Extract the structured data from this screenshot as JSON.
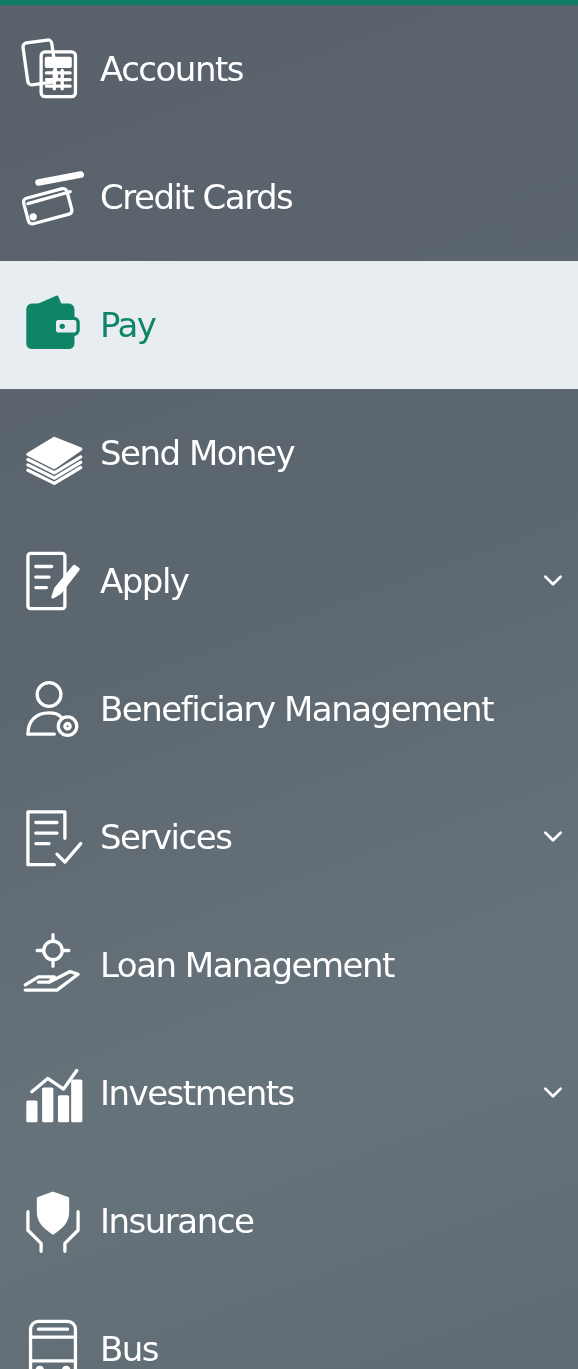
{
  "menu": [
    {
      "label": "Accounts",
      "kind": "link",
      "selected": false
    },
    {
      "label": "Credit Cards",
      "kind": "link",
      "selected": false
    },
    {
      "label": "Pay",
      "kind": "link",
      "selected": true
    },
    {
      "label": "Send Money",
      "kind": "link",
      "selected": false
    },
    {
      "label": "Apply",
      "kind": "group",
      "selected": false
    },
    {
      "label": "Beneficiary Management",
      "kind": "link",
      "selected": false
    },
    {
      "label": "Services",
      "kind": "group",
      "selected": false
    },
    {
      "label": "Loan Management",
      "kind": "link",
      "selected": false
    },
    {
      "label": "Investments",
      "kind": "group",
      "selected": false
    },
    {
      "label": "Insurance",
      "kind": "link",
      "selected": false
    },
    {
      "label": "Bus",
      "kind": "link",
      "selected": false
    }
  ]
}
